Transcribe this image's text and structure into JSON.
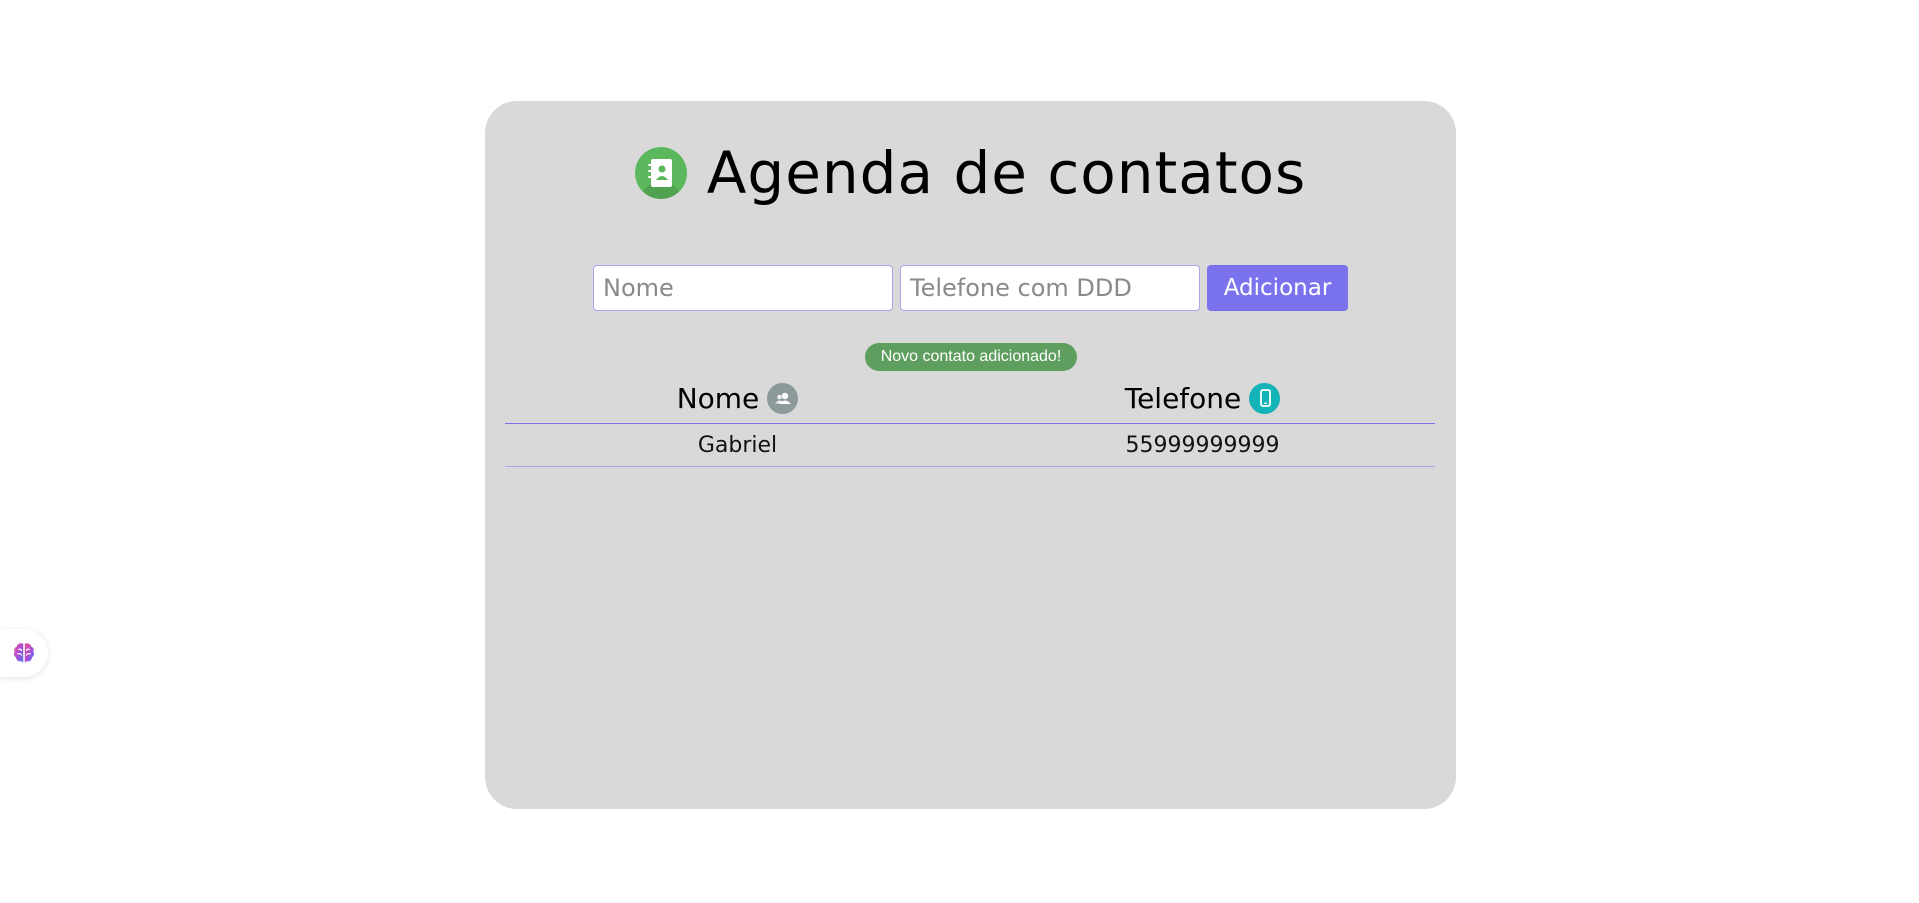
{
  "app": {
    "title": "Agenda de contatos"
  },
  "form": {
    "name_placeholder": "Nome",
    "phone_placeholder": "Telefone com DDD",
    "add_label": "Adicionar"
  },
  "notice": {
    "text": "Novo contato adicionado!"
  },
  "table": {
    "headers": {
      "name": "Nome",
      "phone": "Telefone"
    },
    "rows": [
      {
        "name": "Gabriel",
        "phone": "55999999999"
      }
    ]
  },
  "icons": {
    "title": "address-book-icon",
    "name_header": "user-icon",
    "phone_header": "mobile-phone-icon",
    "extension": "brain-icon"
  },
  "colors": {
    "card_background": "#d9d9d9",
    "accent": "#7b73ee",
    "success": "#5e9e5e",
    "address_book_icon": "#5cb85c",
    "phone_icon": "#14b3b8",
    "user_icon": "#8c9a9c"
  }
}
